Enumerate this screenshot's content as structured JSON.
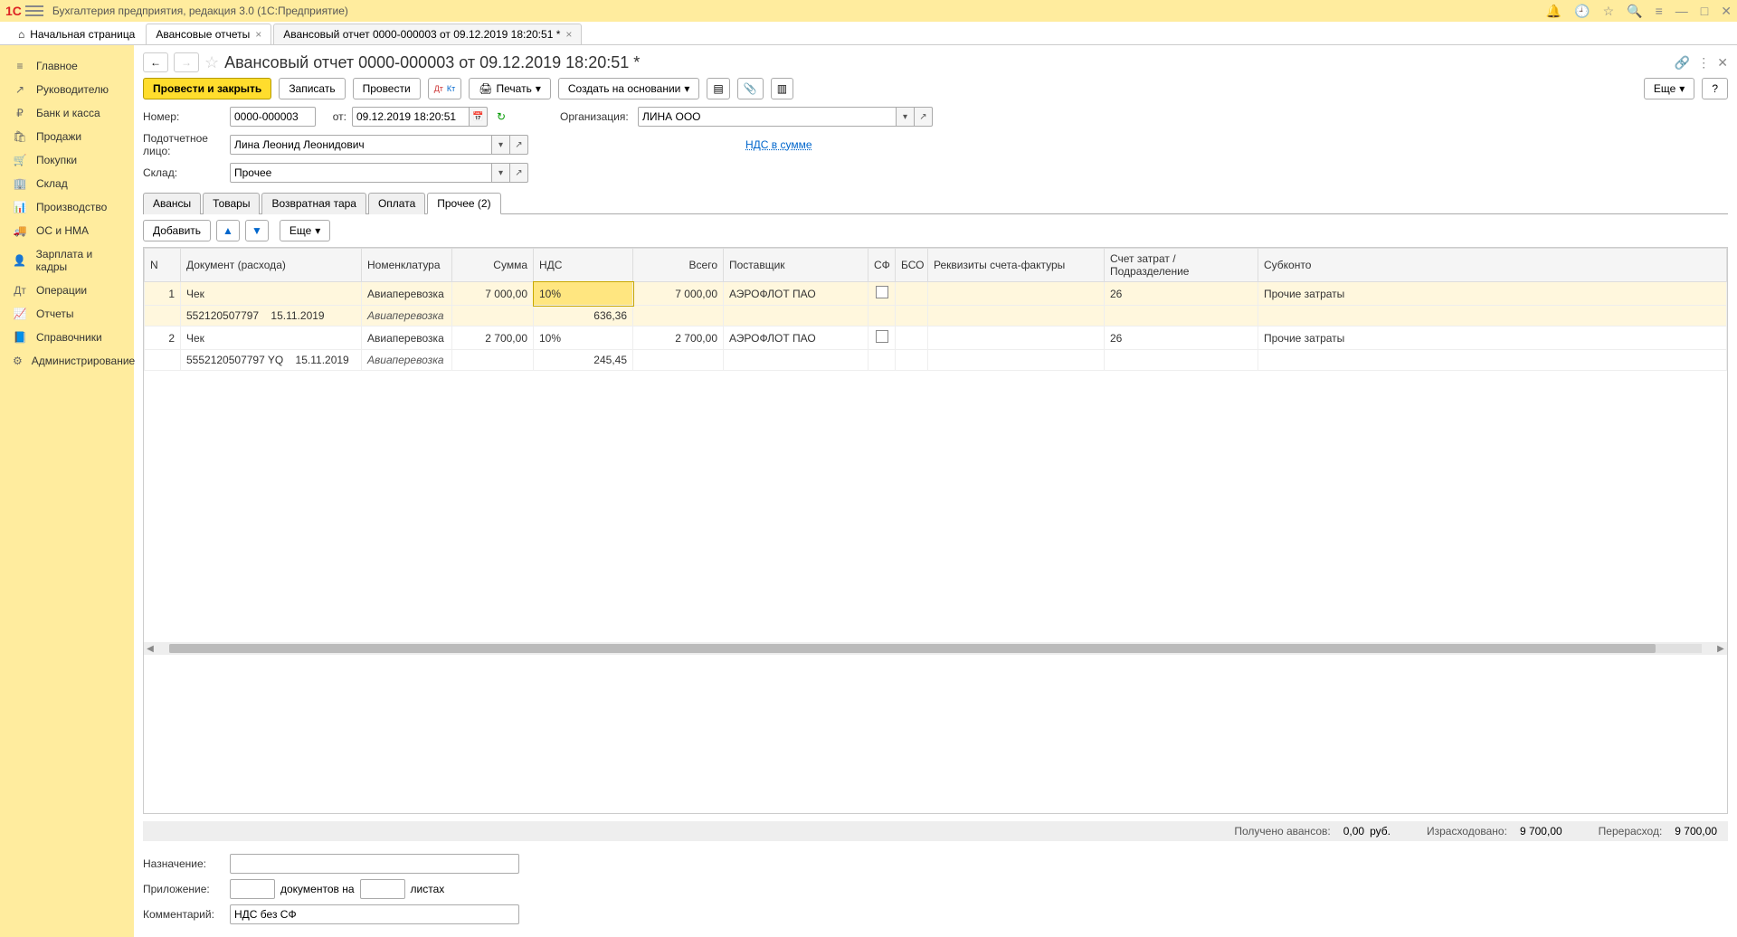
{
  "titlebar": {
    "logo": "1C",
    "app_title": "Бухгалтерия предприятия, редакция 3.0  (1С:Предприятие)"
  },
  "tabs": {
    "home": "Начальная страница",
    "list": "Авансовые отчеты",
    "doc": "Авансовый отчет 0000-000003 от 09.12.2019 18:20:51 *"
  },
  "sidebar": [
    {
      "icon": "≡",
      "label": "Главное"
    },
    {
      "icon": "↗",
      "label": "Руководителю"
    },
    {
      "icon": "₽",
      "label": "Банк и касса"
    },
    {
      "icon": "🛍",
      "label": "Продажи"
    },
    {
      "icon": "🛒",
      "label": "Покупки"
    },
    {
      "icon": "🏢",
      "label": "Склад"
    },
    {
      "icon": "📊",
      "label": "Производство"
    },
    {
      "icon": "🚚",
      "label": "ОС и НМА"
    },
    {
      "icon": "👤",
      "label": "Зарплата и кадры"
    },
    {
      "icon": "Дт",
      "label": "Операции"
    },
    {
      "icon": "📈",
      "label": "Отчеты"
    },
    {
      "icon": "📘",
      "label": "Справочники"
    },
    {
      "icon": "⚙",
      "label": "Администрирование"
    }
  ],
  "doc": {
    "title": "Авансовый отчет 0000-000003 от 09.12.2019 18:20:51 *"
  },
  "toolbar": {
    "post_close": "Провести и закрыть",
    "save": "Записать",
    "post": "Провести",
    "print": "Печать",
    "create_based": "Создать на основании",
    "more": "Еще",
    "help": "?"
  },
  "fields": {
    "number_label": "Номер:",
    "number": "0000-000003",
    "from": "от:",
    "date": "09.12.2019 18:20:51",
    "org_label": "Организация:",
    "org": "ЛИНА ООО",
    "person_label": "Подотчетное лицо:",
    "person": "Лина Леонид Леонидович",
    "nds_link": "НДС в сумме",
    "warehouse_label": "Склад:",
    "warehouse": "Прочее"
  },
  "tabs2": {
    "advances": "Авансы",
    "goods": "Товары",
    "returnable": "Возвратная тара",
    "payment": "Оплата",
    "other": "Прочее (2)"
  },
  "subtoolbar": {
    "add": "Добавить",
    "more": "Еще"
  },
  "grid": {
    "headers": {
      "n": "N",
      "doc": "Документ (расхода)",
      "nomen": "Номенклатура",
      "sum": "Сумма",
      "nds": "НДС",
      "total": "Всего",
      "supplier": "Поставщик",
      "sf": "СФ",
      "bso": "БСО",
      "sf_req": "Реквизиты счета-фактуры",
      "account": "Счет затрат / Подразделение",
      "subconto": "Субконто"
    },
    "rows": [
      {
        "n": "1",
        "doc": "Чек",
        "nomen": "Авиаперевозка",
        "sum": "7 000,00",
        "nds": "10%",
        "total": "7 000,00",
        "supplier": "АЭРОФЛОТ ПАО",
        "account": "26",
        "subconto": "Прочие затраты",
        "doc_no": "552120507797",
        "doc_date": "15.11.2019",
        "nomen2": "Авиаперевозка",
        "nds_sum": "636,36"
      },
      {
        "n": "2",
        "doc": "Чек",
        "nomen": "Авиаперевозка",
        "sum": "2 700,00",
        "nds": "10%",
        "total": "2 700,00",
        "supplier": "АЭРОФЛОТ ПАО",
        "account": "26",
        "subconto": "Прочие затраты",
        "doc_no": "5552120507797 YQ",
        "doc_date": "15.11.2019",
        "nomen2": "Авиаперевозка",
        "nds_sum": "245,45"
      }
    ]
  },
  "totals": {
    "received_label": "Получено авансов:",
    "received": "0,00",
    "rub": "руб.",
    "spent_label": "Израсходовано:",
    "spent": "9 700,00",
    "over_label": "Перерасход:",
    "over": "9 700,00"
  },
  "bottom": {
    "purpose_label": "Назначение:",
    "att_label": "Приложение:",
    "docs_on": "документов на",
    "sheets": "листах",
    "comment_label": "Комментарий:",
    "comment": "НДС без СФ"
  }
}
